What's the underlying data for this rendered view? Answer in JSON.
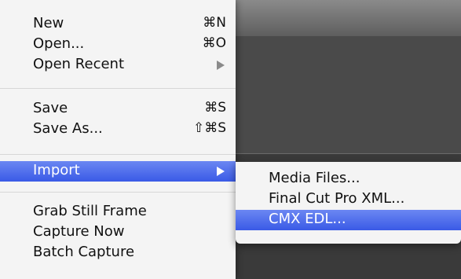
{
  "file_menu": {
    "items": [
      {
        "label": "New",
        "shortcut": "⌘N"
      },
      {
        "label": "Open...",
        "shortcut": "⌘O"
      },
      {
        "label": "Open Recent",
        "has_submenu": true
      },
      {
        "label": "Save",
        "shortcut": "⌘S"
      },
      {
        "label": "Save As...",
        "shortcut": "⇧⌘S"
      },
      {
        "label": "Import",
        "has_submenu": true,
        "selected": true
      },
      {
        "label": "Grab Still Frame"
      },
      {
        "label": "Capture Now"
      },
      {
        "label": "Batch Capture"
      }
    ]
  },
  "import_submenu": {
    "items": [
      {
        "label": "Media Files..."
      },
      {
        "label": "Final Cut Pro XML..."
      },
      {
        "label": "CMX EDL...",
        "selected": true
      }
    ]
  },
  "colors": {
    "selection_top": "#6b87f2",
    "selection_bottom": "#3a5ae6",
    "menu_bg": "#f8f8f8",
    "separator": "#d7d7d7",
    "background_window": "#3a3a3a"
  },
  "icons": {
    "submenu_arrow": "right-triangle-icon"
  }
}
